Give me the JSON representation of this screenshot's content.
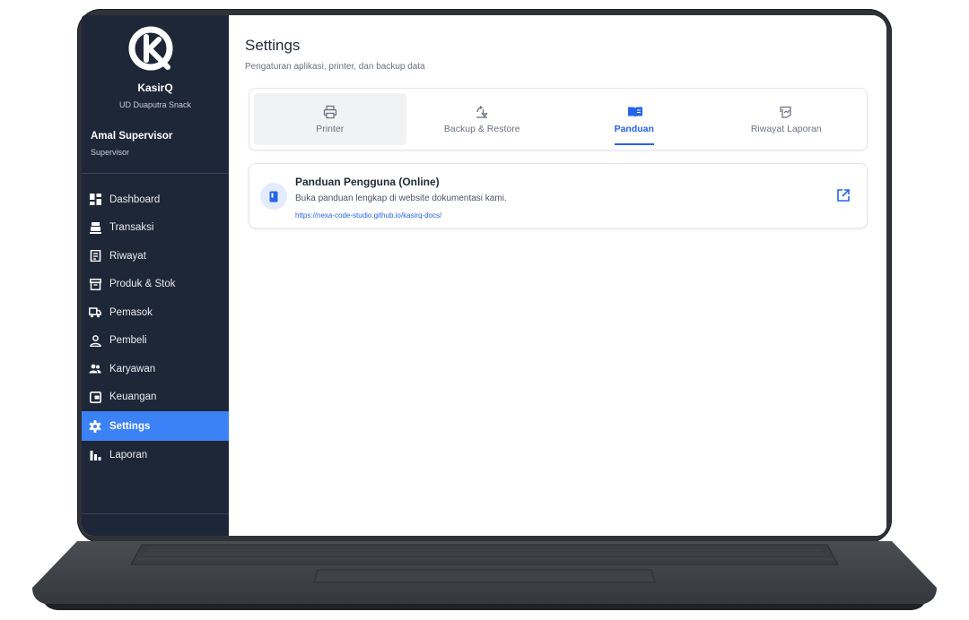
{
  "sidebar": {
    "app_name": "KasirQ",
    "store_name": "UD Duaputra Snack",
    "user_name": "Amal Supervisor",
    "user_role": "Supervisor",
    "items": [
      {
        "label": "Dashboard",
        "icon": "dashboard-icon"
      },
      {
        "label": "Transaksi",
        "icon": "register-icon"
      },
      {
        "label": "Riwayat",
        "icon": "receipt-icon"
      },
      {
        "label": "Produk & Stok",
        "icon": "box-icon"
      },
      {
        "label": "Pemasok",
        "icon": "truck-icon"
      },
      {
        "label": "Pembeli",
        "icon": "user-icon"
      },
      {
        "label": "Karyawan",
        "icon": "users-icon"
      },
      {
        "label": "Keuangan",
        "icon": "wallet-icon"
      },
      {
        "label": "Settings",
        "icon": "gear-icon",
        "active": true
      },
      {
        "label": "Laporan",
        "icon": "bar-chart-icon"
      }
    ]
  },
  "main": {
    "title": "Settings",
    "subtitle": "Pengaturan aplikasi, printer, dan backup data",
    "tabs": [
      {
        "label": "Printer",
        "icon": "printer-icon"
      },
      {
        "label": "Backup & Restore",
        "icon": "backup-icon"
      },
      {
        "label": "Panduan",
        "icon": "book-icon",
        "active": true
      },
      {
        "label": "Riwayat Laporan",
        "icon": "report-history-icon"
      }
    ],
    "guide": {
      "title": "Panduan Pengguna (Online)",
      "description": "Buka panduan lengkap di website dokumentasi kami.",
      "link": "https://nexa-code-studio.github.io/kasirq-docs/"
    }
  },
  "colors": {
    "sidebar_bg": "#1e2738",
    "accent": "#3b82f6",
    "tab_active": "#2563eb"
  }
}
